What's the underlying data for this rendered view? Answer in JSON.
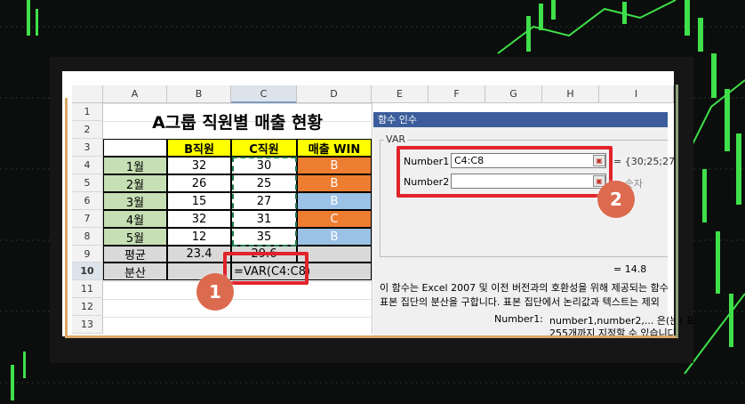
{
  "sheet": {
    "columns": [
      "A",
      "B",
      "C",
      "D",
      "E",
      "F",
      "G",
      "H",
      "I"
    ],
    "rows": [
      "1",
      "2",
      "3",
      "4",
      "5",
      "6",
      "7",
      "8",
      "9",
      "10",
      "11",
      "12",
      "13"
    ],
    "title": "A그룹 직원별 매출 현황",
    "headers": {
      "b": "B직원",
      "c": "C직원",
      "d": "매출 WIN"
    },
    "months": [
      "1월",
      "2월",
      "3월",
      "4월",
      "5월"
    ],
    "b_values": [
      "32",
      "26",
      "15",
      "32",
      "12"
    ],
    "c_values": [
      "30",
      "25",
      "27",
      "31",
      "35"
    ],
    "win": [
      "B",
      "B",
      "B",
      "C",
      "B"
    ],
    "avg_label": "평균",
    "avg_b": "23.4",
    "avg_c": "29.6",
    "var_label": "분산",
    "formula": "=VAR(C4:C8)"
  },
  "dialog": {
    "title": "함수 인수",
    "function_name": "VAR",
    "arg1_label": "Number1",
    "arg1_value": "C4:C8",
    "arg1_preview": "= {30;25;27",
    "arg2_label": "Number2",
    "arg2_value": "",
    "arg2_preview": "= 숫자",
    "result": "=   14.8",
    "description_line1": "이 함수는 Excel 2007 및 이전 버전과의 호환성을 위해 제공되는 함수",
    "description_line2": "표본 집단의 분산을 구합니다. 표본 집단에서 논리값과 텍스트는 제외",
    "arg_help_label": "Number1:",
    "arg_help_text": "number1,number2,... 은(는) 표",
    "arg_help_line2": "255개까지 지정할 수 있습니다."
  },
  "callouts": {
    "one": "1",
    "two": "2"
  },
  "colors": {
    "header_yellow": "#ffff00",
    "month_green": "#c6dfb4",
    "win_orange": "#ed7d31",
    "win_blue": "#9bc2e6",
    "callout": "#dc6a4f",
    "highlight_red": "#e1232a",
    "dialog_title": "#3c5d9b"
  }
}
